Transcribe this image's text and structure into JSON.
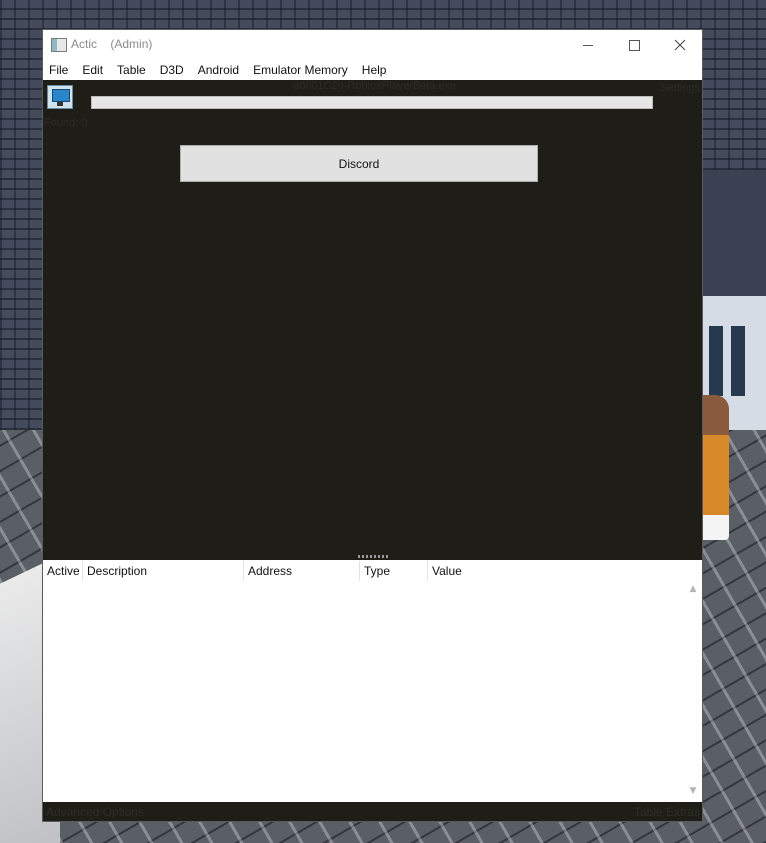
{
  "window": {
    "title": "Actic",
    "title_suffix": "    (Admin)",
    "controls": {
      "minimize": "minimize",
      "maximize": "maximize",
      "close": "close"
    }
  },
  "menu": [
    "File",
    "Edit",
    "Table",
    "D3D",
    "Android",
    "Emulator Memory",
    "Help"
  ],
  "process": {
    "name": "00001C20-RobloxPlayerBeta.exe",
    "settings_label": "Settings",
    "found_label": "Found: 0",
    "scan_progress": 0
  },
  "discord_button": "Discord",
  "table": {
    "columns": [
      "Active",
      "Description",
      "Address",
      "Type",
      "Value"
    ],
    "rows": []
  },
  "statusbar": {
    "left": "Advanced Options",
    "right": "Table Extras"
  },
  "colors": {
    "window_bg": "#1e1d18",
    "button_bg": "#e1e1e1",
    "table_bg": "#ffffff"
  }
}
